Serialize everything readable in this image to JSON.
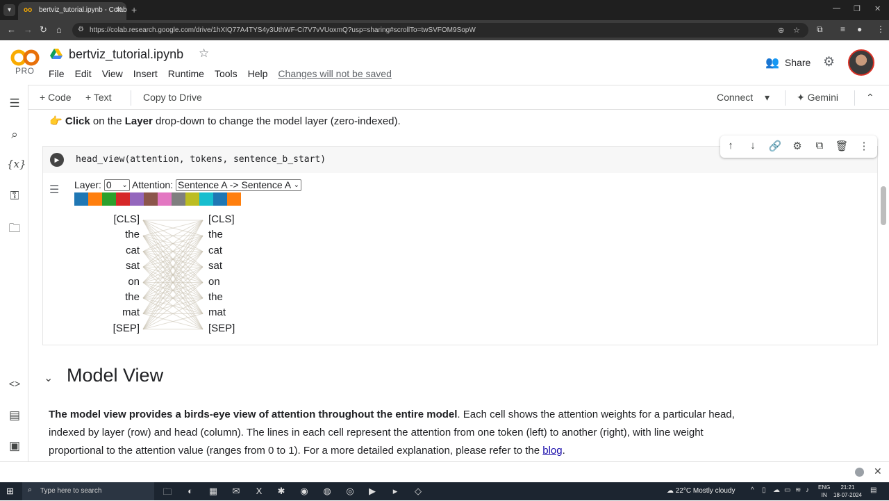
{
  "browser": {
    "tab_title": "bertviz_tutorial.ipynb - Colab",
    "url": "https://colab.research.google.com/drive/1hXIQ77A4TYS4y3UthWF-Ci7V7vVUoxmQ?usp=sharing#scrollTo=twSVFOM9SopW"
  },
  "header": {
    "logo_text": "CO",
    "plan": "PRO",
    "notebook_title": "bertviz_tutorial.ipynb",
    "menu": [
      "File",
      "Edit",
      "View",
      "Insert",
      "Runtime",
      "Tools",
      "Help"
    ],
    "unsaved_notice": "Changes will not be saved",
    "share_label": "Share"
  },
  "toolbar": {
    "code_label": "+ Code",
    "text_label": "+ Text",
    "copy_label": "Copy to Drive",
    "connect_label": "Connect",
    "gemini_label": "Gemini"
  },
  "rail": {
    "variables_label": "{x}"
  },
  "content": {
    "instruction": {
      "bold1": "Click",
      "text1": " on the ",
      "bold2": "Layer",
      "text2": " drop-down to change the model layer (zero-indexed)."
    },
    "code": "head_view(attention, tokens, sentence_b_start)",
    "layer_label": "Layer:",
    "layer_value": "0",
    "attention_label": "Attention:",
    "attention_value": "Sentence A -> Sentence A",
    "head_colors": [
      "#1f77b4",
      "#ff7f0e",
      "#2ca02c",
      "#d62728",
      "#9467bd",
      "#8c564b",
      "#e377c2",
      "#7f7f7f",
      "#bcbd22",
      "#17becf",
      "#1f77b4",
      "#ff7f0e"
    ],
    "tokens_left": [
      "[CLS]",
      "the",
      "cat",
      "sat",
      "on",
      "the",
      "mat",
      "[SEP]"
    ],
    "tokens_right": [
      "[CLS]",
      "the",
      "cat",
      "sat",
      "on",
      "the",
      "mat",
      "[SEP]"
    ],
    "section_title": "Model View",
    "paragraph": {
      "bold": "The model view provides a birds-eye view of attention throughout the entire model",
      "text": ". Each cell shows the attention weights for a particular head, indexed by layer (row) and head (column). The lines in each cell represent the attention from one token (left) to another (right), with line weight proportional to the attention value (ranges from 0 to 1). For a more detailed explanation, please refer to the ",
      "link": "blog",
      "end": "."
    }
  },
  "taskbar": {
    "search_placeholder": "Type here to search",
    "weather": "22°C  Mostly cloudy",
    "lang1": "ENG",
    "lang2": "IN",
    "time": "21:21",
    "date": "18-07-2024"
  }
}
